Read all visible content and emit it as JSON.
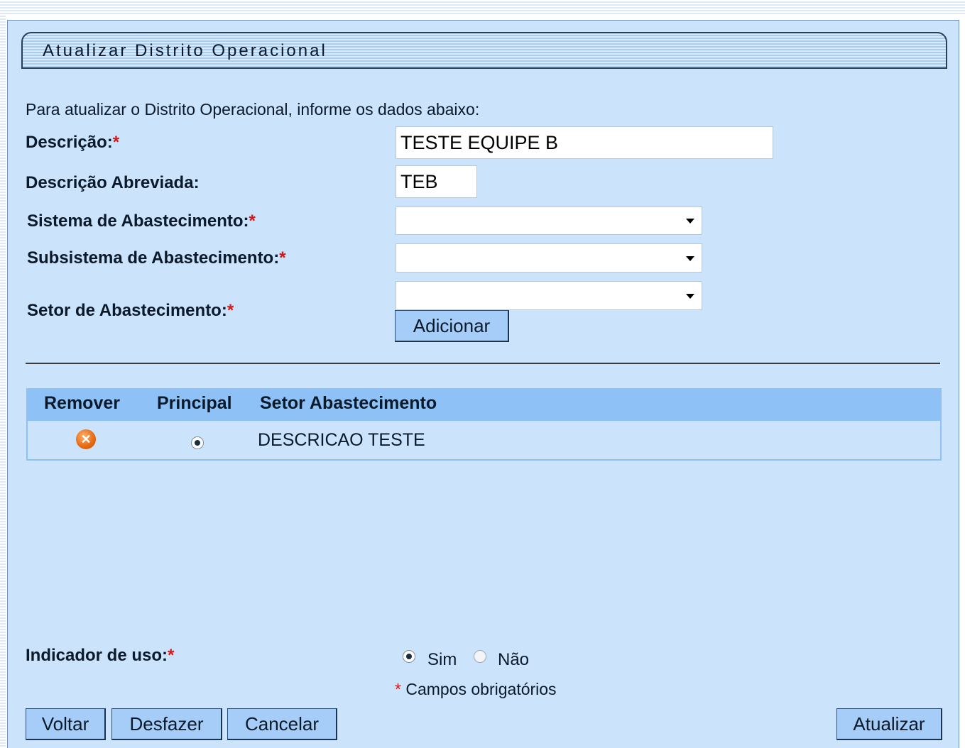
{
  "window": {
    "title": "Atualizar Distrito Operacional"
  },
  "form": {
    "intro": "Para atualizar o Distrito Operacional, informe os dados abaixo:",
    "required_mark": "*",
    "descricao": {
      "label": "Descrição:",
      "value": "TESTE EQUIPE B"
    },
    "descricao_abreviada": {
      "label": "Descrição Abreviada:",
      "value": "TEB"
    },
    "sistema": {
      "label": "Sistema de Abastecimento:",
      "value": ""
    },
    "subsistema": {
      "label": "Subsistema de Abastecimento:",
      "value": ""
    },
    "setor": {
      "label": "Setor de Abastecimento:",
      "value": ""
    },
    "add_button": "Adicionar"
  },
  "table": {
    "headers": [
      "Remover",
      "Principal",
      "Setor Abastecimento"
    ],
    "rows": [
      {
        "remove_icon": "remove-icon",
        "principal_selected": true,
        "setor": "DESCRICAO TESTE"
      }
    ]
  },
  "indicador_uso": {
    "label": "Indicador de uso:",
    "options": [
      {
        "label": "Sim",
        "selected": true
      },
      {
        "label": "Não",
        "selected": false
      }
    ]
  },
  "required_note": "Campos obrigatórios",
  "buttons": {
    "voltar": "Voltar",
    "desfazer": "Desfazer",
    "cancelar": "Cancelar",
    "atualizar": "Atualizar"
  },
  "colors": {
    "panel_bg": "#cbe3fb",
    "table_header_bg": "#8ec2f7",
    "button_bg": "#a6cdf7",
    "required": "#d01818",
    "remove_icon": "#e86d14"
  }
}
